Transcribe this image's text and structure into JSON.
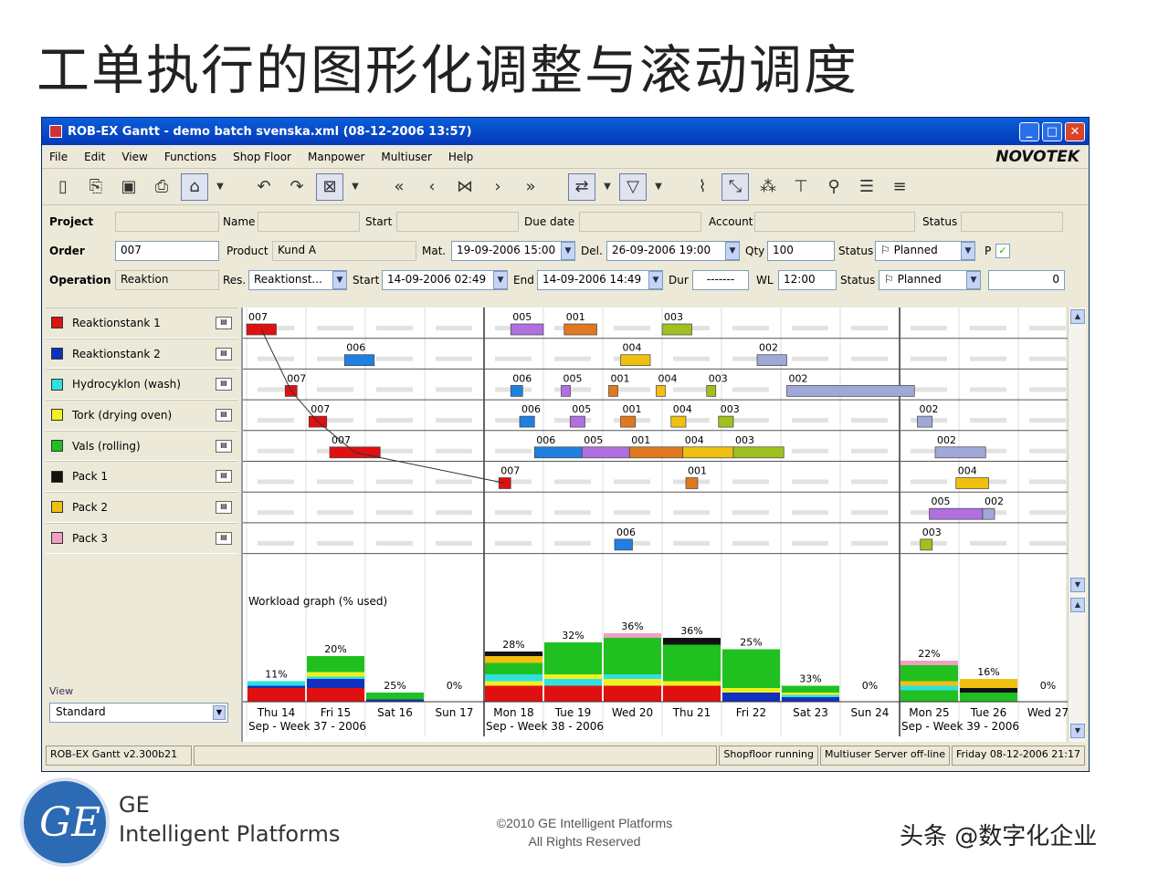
{
  "slide": {
    "title": "工单执行的图形化调整与滚动调度",
    "company_line1": "GE",
    "company_line2": "Intelligent Platforms",
    "copyright_line1": "©2010 GE Intelligent Platforms",
    "copyright_line2": "All Rights Reserved",
    "watermark": "头条 @数字化企业",
    "logo": "GE"
  },
  "window": {
    "title": "ROB-EX Gantt - demo batch svenska.xml (08-12-2006 13:57)",
    "brand": "NOVOTEK",
    "controls": [
      "minimize",
      "maximize",
      "close"
    ]
  },
  "menu": [
    "File",
    "Edit",
    "View",
    "Functions",
    "Shop Floor",
    "Manpower",
    "Multiuser",
    "Help"
  ],
  "toolbar": [
    "new-icon",
    "open-icon",
    "save-icon",
    "print-icon",
    "export-html-icon",
    "dropdown-icon",
    "undo-icon",
    "redo-icon",
    "gantt-view-icon",
    "dropdown-icon",
    "fast-back-icon",
    "back-icon",
    "center-icon",
    "forward-icon",
    "fast-forward-icon",
    "link-icon",
    "dropdown-icon",
    "filter-icon",
    "dropdown-icon",
    "chart-icon",
    "connector-icon",
    "network-icon",
    "tree-icon",
    "zoom-icon",
    "table-icon",
    "list-icon"
  ],
  "form": {
    "project_label": "Project",
    "name_label": "Name",
    "start_label": "Start",
    "due_label": "Due date",
    "account_label": "Account",
    "status_label": "Status",
    "order_label": "Order",
    "order_value": "007",
    "product_label": "Product",
    "product_value": "Kund A",
    "mat_label": "Mat.",
    "mat_value": "19-09-2006 15:00",
    "del_label": "Del.",
    "del_value": "26-09-2006 19:00",
    "qty_label": "Qty",
    "qty_value": "100",
    "order_status_value": "Planned",
    "p_label": "P",
    "p_checked": true,
    "operation_label": "Operation",
    "operation_value": "Reaktion",
    "res_label": "Res.",
    "res_value": "Reaktionst...",
    "op_start_label": "Start",
    "op_start_value": "14-09-2006 02:49",
    "end_label": "End",
    "end_value": "14-09-2006 14:49",
    "dur_label": "Dur",
    "dur_value": "-------",
    "wl_label": "WL",
    "wl_value": "12:00",
    "op_status_value": "Planned",
    "num_value": "0"
  },
  "resources": [
    {
      "name": "Reaktionstank 1",
      "color": "#e01010"
    },
    {
      "name": "Reaktionstank 2",
      "color": "#1030c0"
    },
    {
      "name": "Hydrocyklon (wash)",
      "color": "#30e0e0"
    },
    {
      "name": "Tork (drying oven)",
      "color": "#f0f020"
    },
    {
      "name": "Vals (rolling)",
      "color": "#20c020"
    },
    {
      "name": "Pack 1",
      "color": "#111111"
    },
    {
      "name": "Pack 2",
      "color": "#f0c010"
    },
    {
      "name": "Pack 3",
      "color": "#f0a0c0"
    }
  ],
  "view": {
    "label": "View",
    "value": "Standard"
  },
  "gantt": {
    "ops": [
      {
        "row": 0,
        "order": "007",
        "col": 0.0,
        "len": 0.5,
        "color": "#e01010",
        "label": true
      },
      {
        "row": 0,
        "order": "005",
        "col": 4.45,
        "len": 0.55,
        "color": "#b070e0",
        "label": true
      },
      {
        "row": 0,
        "order": "001",
        "col": 5.35,
        "len": 0.55,
        "color": "#e07820",
        "label": true
      },
      {
        "row": 0,
        "order": "003",
        "col": 7.0,
        "len": 0.5,
        "color": "#a0c020",
        "label": true
      },
      {
        "row": 1,
        "order": "006",
        "col": 1.65,
        "len": 0.5,
        "color": "#2080e0",
        "label": true
      },
      {
        "row": 1,
        "order": "004",
        "col": 6.3,
        "len": 0.5,
        "color": "#f0c010",
        "label": true
      },
      {
        "row": 1,
        "order": "002",
        "col": 8.6,
        "len": 0.5,
        "color": "#a0a8d8",
        "label": true
      },
      {
        "row": 2,
        "order": "007",
        "col": 0.65,
        "len": 0.2,
        "color": "#e01010",
        "label": true
      },
      {
        "row": 2,
        "order": "006",
        "col": 4.45,
        "len": 0.2,
        "color": "#2080e0",
        "label": true
      },
      {
        "row": 2,
        "order": "005",
        "col": 5.3,
        "len": 0.15,
        "color": "#b070e0",
        "label": true
      },
      {
        "row": 2,
        "order": "001",
        "col": 6.1,
        "len": 0.15,
        "color": "#e07820",
        "label": true
      },
      {
        "row": 2,
        "order": "004",
        "col": 6.9,
        "len": 0.15,
        "color": "#f0c010",
        "label": true
      },
      {
        "row": 2,
        "order": "003",
        "col": 7.75,
        "len": 0.15,
        "color": "#a0c020",
        "label": true
      },
      {
        "row": 2,
        "order": "002",
        "col": 9.1,
        "len": 2.15,
        "color": "#a0a8d8",
        "label": true
      },
      {
        "row": 3,
        "order": "007",
        "col": 1.05,
        "len": 0.3,
        "color": "#e01010",
        "label": true
      },
      {
        "row": 3,
        "order": "006",
        "col": 4.6,
        "len": 0.25,
        "color": "#2080e0",
        "label": true
      },
      {
        "row": 3,
        "order": "005",
        "col": 5.45,
        "len": 0.25,
        "color": "#b070e0",
        "label": true
      },
      {
        "row": 3,
        "order": "001",
        "col": 6.3,
        "len": 0.25,
        "color": "#e07820",
        "label": true
      },
      {
        "row": 3,
        "order": "004",
        "col": 7.15,
        "len": 0.25,
        "color": "#f0c010",
        "label": true
      },
      {
        "row": 3,
        "order": "003",
        "col": 7.95,
        "len": 0.25,
        "color": "#a0c020",
        "label": true
      },
      {
        "row": 3,
        "order": "002",
        "col": 11.3,
        "len": 0.25,
        "color": "#a0a8d8",
        "label": true
      },
      {
        "row": 4,
        "order": "007",
        "col": 1.4,
        "len": 0.85,
        "color": "#e01010",
        "label": true
      },
      {
        "row": 4,
        "order": "006",
        "col": 4.85,
        "len": 0.8,
        "color": "#2080e0",
        "label": true
      },
      {
        "row": 4,
        "order": "005",
        "col": 5.65,
        "len": 0.8,
        "color": "#b070e0",
        "label": true
      },
      {
        "row": 4,
        "order": "001",
        "col": 6.45,
        "len": 0.9,
        "color": "#e07820",
        "label": true
      },
      {
        "row": 4,
        "order": "004",
        "col": 7.35,
        "len": 0.85,
        "color": "#f0c010",
        "label": true
      },
      {
        "row": 4,
        "order": "003",
        "col": 8.2,
        "len": 0.85,
        "color": "#a0c020",
        "label": true
      },
      {
        "row": 4,
        "order": "002",
        "col": 11.6,
        "len": 0.85,
        "color": "#a0a8d8",
        "label": true
      },
      {
        "row": 5,
        "order": "007",
        "col": 4.25,
        "len": 0.2,
        "color": "#e01010",
        "label": true
      },
      {
        "row": 5,
        "order": "001",
        "col": 7.4,
        "len": 0.2,
        "color": "#e07820",
        "label": true
      },
      {
        "row": 5,
        "order": "004",
        "col": 11.95,
        "len": 0.55,
        "color": "#f0c010",
        "label": true
      },
      {
        "row": 6,
        "order": "005",
        "col": 11.5,
        "len": 0.9,
        "color": "#b070e0",
        "label": true
      },
      {
        "row": 6,
        "order": "002",
        "col": 12.4,
        "len": 0.2,
        "color": "#a0a8d8",
        "label": true
      },
      {
        "row": 7,
        "order": "006",
        "col": 6.2,
        "len": 0.3,
        "color": "#2080e0",
        "label": true
      },
      {
        "row": 7,
        "order": "003",
        "col": 11.35,
        "len": 0.2,
        "color": "#a0c020",
        "label": true
      }
    ],
    "day_labels": [
      "Thu 14",
      "Fri 15",
      "Sat 16",
      "Sun 17",
      "Mon 18",
      "Tue 19",
      "Wed 20",
      "Thu 21",
      "Fri 22",
      "Sat 23",
      "Sun 24",
      "Mon 25",
      "Tue 26",
      "Wed 27"
    ],
    "week_labels": [
      "Sep - Week 37 - 2006",
      "Sep - Week 38 - 2006",
      "Sep - Week 39 - 2006"
    ],
    "workload_title": "Workload graph (% used)",
    "workload": [
      {
        "label": "11%",
        "pct": 11,
        "stack": [
          [
            "#e01010",
            6
          ],
          [
            "#1030c0",
            1
          ],
          [
            "#30e0e0",
            2
          ],
          [
            "#f0f020",
            0
          ],
          [
            "#20c020",
            0
          ]
        ]
      },
      {
        "label": "20%",
        "pct": 20,
        "stack": [
          [
            "#e01010",
            6
          ],
          [
            "#1030c0",
            4
          ],
          [
            "#30e0e0",
            1
          ],
          [
            "#f0f020",
            2
          ],
          [
            "#20c020",
            7
          ]
        ]
      },
      {
        "label": "25%",
        "pct": 25,
        "stack": [
          [
            "#1030c0",
            1
          ],
          [
            "#30e0e0",
            0
          ],
          [
            "#20c020",
            3
          ]
        ]
      },
      {
        "label": "0%",
        "pct": 0,
        "stack": []
      },
      {
        "label": "28%",
        "pct": 28,
        "stack": [
          [
            "#e01010",
            7
          ],
          [
            "#f0f020",
            2
          ],
          [
            "#30e0e0",
            3
          ],
          [
            "#20c020",
            5
          ],
          [
            "#f0c010",
            3
          ],
          [
            "#111111",
            2
          ]
        ]
      },
      {
        "label": "32%",
        "pct": 32,
        "stack": [
          [
            "#e01010",
            7
          ],
          [
            "#30e0e0",
            3
          ],
          [
            "#f0f020",
            2
          ],
          [
            "#20c020",
            14
          ]
        ]
      },
      {
        "label": "36%",
        "pct": 36,
        "stack": [
          [
            "#e01010",
            7
          ],
          [
            "#f0f020",
            3
          ],
          [
            "#30e0e0",
            2
          ],
          [
            "#20c020",
            16
          ],
          [
            "#f0a0c0",
            2
          ]
        ]
      },
      {
        "label": "36%",
        "pct": 36,
        "stack": [
          [
            "#e01010",
            7
          ],
          [
            "#f0f020",
            2
          ],
          [
            "#20c020",
            16
          ],
          [
            "#111111",
            3
          ]
        ]
      },
      {
        "label": "25%",
        "pct": 25,
        "stack": [
          [
            "#1030c0",
            4
          ],
          [
            "#f0f020",
            2
          ],
          [
            "#20c020",
            17
          ]
        ]
      },
      {
        "label": "33%",
        "pct": 33,
        "stack": [
          [
            "#1030c0",
            2
          ],
          [
            "#30e0e0",
            1
          ],
          [
            "#f0f020",
            1
          ],
          [
            "#20c020",
            3
          ]
        ]
      },
      {
        "label": "0%",
        "pct": 0,
        "stack": []
      },
      {
        "label": "22%",
        "pct": 22,
        "stack": [
          [
            "#20c020",
            5
          ],
          [
            "#30e0e0",
            2
          ],
          [
            "#f0c010",
            2
          ],
          [
            "#20c020",
            7
          ],
          [
            "#f0a0c0",
            2
          ]
        ]
      },
      {
        "label": "16%",
        "pct": 16,
        "stack": [
          [
            "#20c020",
            4
          ],
          [
            "#111111",
            2
          ],
          [
            "#f0c010",
            4
          ]
        ]
      },
      {
        "label": "0%",
        "pct": 0,
        "stack": []
      }
    ]
  },
  "status": {
    "version": "ROB-EX Gantt v2.300b21",
    "shopfloor": "Shopfloor running",
    "multiuser": "Multiuser Server off-line",
    "datetime": "Friday 08-12-2006 21:17"
  }
}
